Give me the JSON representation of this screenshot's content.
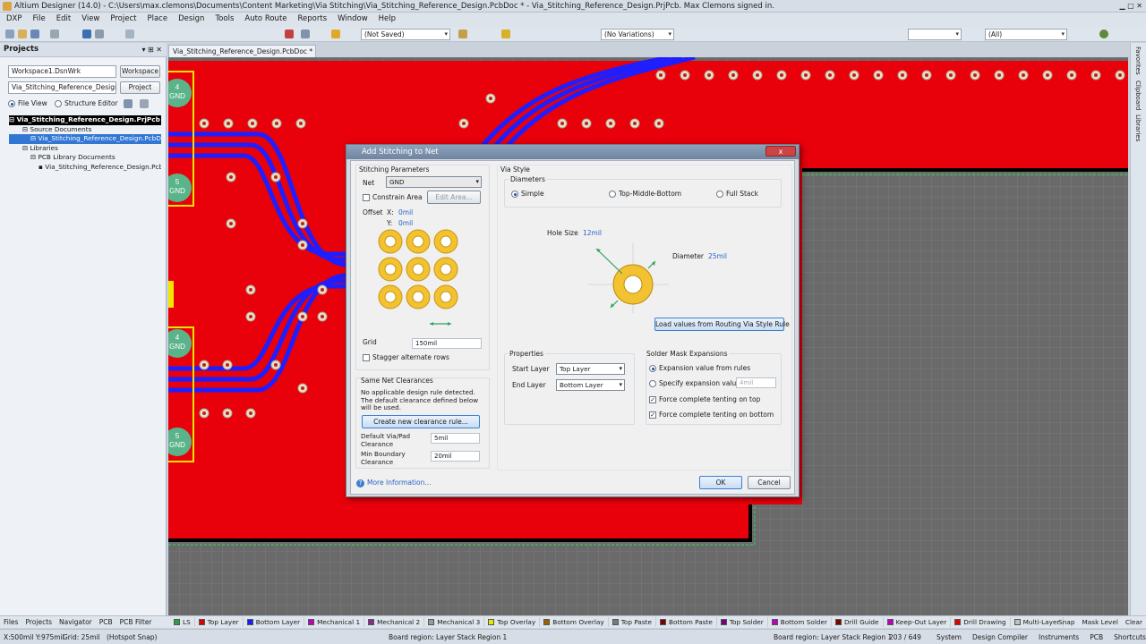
{
  "window": {
    "title": "Altium Designer (14.0) - C:\\Users\\max.clemons\\Documents\\Content Marketing\\Via Stitching\\Via_Stitching_Reference_Design.PcbDoc * - Via_Stitching_Reference_Design.PrjPcb. Max Clemons signed in."
  },
  "menu": [
    "DXP",
    "File",
    "Edit",
    "View",
    "Project",
    "Place",
    "Design",
    "Tools",
    "Auto Route",
    "Reports",
    "Window",
    "Help"
  ],
  "toolbar": {
    "saved_state": "(Not Saved)",
    "variations": "(No Variations)",
    "filter": "(All)"
  },
  "projects_panel": {
    "title": "Projects",
    "workspace_combo": "Workspace1.DsnWrk",
    "workspace_button": "Workspace",
    "project_combo": "Via_Stitching_Reference_Design.PrjPcb",
    "project_button": "Project",
    "file_view": "File View",
    "structure_editor": "Structure Editor",
    "tree": [
      {
        "label": "Via_Stitching_Reference_Design.PrjPcb",
        "level": 0,
        "style": "root"
      },
      {
        "label": "Source Documents",
        "level": 1,
        "style": ""
      },
      {
        "label": "Via_Stitching_Reference_Design.PcbDoc",
        "level": 2,
        "style": "sel"
      },
      {
        "label": "Libraries",
        "level": 1,
        "style": ""
      },
      {
        "label": "PCB Library Documents",
        "level": 2,
        "style": ""
      },
      {
        "label": "Via_Stitching_Reference_Design.PcbLib",
        "level": 3,
        "style": ""
      }
    ]
  },
  "document_tab": "Via_Stitching_Reference_Design.PcbDoc *",
  "right_strip": [
    "Favorites",
    "Clipboard",
    "Libraries"
  ],
  "pads": [
    {
      "num": "4",
      "net": "GND"
    },
    {
      "num": "5",
      "net": "GND"
    },
    {
      "num": "4",
      "net": "GND"
    },
    {
      "num": "5",
      "net": "GND"
    }
  ],
  "dialog": {
    "title": "Add Stitching to Net",
    "close": "x",
    "stitching_parameters": "Stitching Parameters",
    "net_label": "Net",
    "net_value": "GND",
    "constrain_area": "Constrain Area",
    "edit_area": "Edit Area...",
    "offset_label": "Offset",
    "offset_x_label": "X:",
    "offset_x": "0mil",
    "offset_y_label": "Y:",
    "offset_y": "0mil",
    "grid_label": "Grid",
    "grid_value": "150mil",
    "stagger": "Stagger alternate rows",
    "same_net_clearances": "Same Net Clearances",
    "clearance_note": "No applicable design rule detected. The default clearance defined below will be used.",
    "create_rule": "Create new clearance rule...",
    "default_via_label": "Default Via/Pad Clearance",
    "default_via_value": "5mil",
    "min_boundary_label": "Min Boundary Clearance",
    "min_boundary_value": "20mil",
    "more_info": "More Information...",
    "via_style": "Via Style",
    "diameters": "Diameters",
    "opt_simple": "Simple",
    "opt_tmb": "Top-Middle-Bottom",
    "opt_full": "Full Stack",
    "hole_size_label": "Hole Size",
    "hole_size": "12mil",
    "diameter_label": "Diameter",
    "diameter": "25mil",
    "load_values": "Load values from Routing Via Style Rule",
    "properties": "Properties",
    "start_layer_label": "Start Layer",
    "start_layer": "Top Layer",
    "end_layer_label": "End Layer",
    "end_layer": "Bottom Layer",
    "solder_mask": "Solder Mask Expansions",
    "mask_from_rules": "Expansion value from rules",
    "mask_specify": "Specify expansion value",
    "mask_value": "4mil",
    "tent_top": "Force complete tenting on top",
    "tent_bottom": "Force complete tenting on bottom",
    "ok": "OK",
    "cancel": "Cancel"
  },
  "panel_tabs": [
    "Files",
    "Projects",
    "Navigator",
    "PCB",
    "PCB Filter"
  ],
  "layers": [
    {
      "name": "LS",
      "color": "#2ea043"
    },
    {
      "name": "Top Layer",
      "color": "#e00000"
    },
    {
      "name": "Bottom Layer",
      "color": "#1a1aff"
    },
    {
      "name": "Mechanical 1",
      "color": "#c000c0"
    },
    {
      "name": "Mechanical 2",
      "color": "#8b2a8b"
    },
    {
      "name": "Mechanical 3",
      "color": "#9a9a9a"
    },
    {
      "name": "Top Overlay",
      "color": "#e6e600"
    },
    {
      "name": "Bottom Overlay",
      "color": "#a06000"
    },
    {
      "name": "Top Paste",
      "color": "#7a7a7a"
    },
    {
      "name": "Bottom Paste",
      "color": "#800000"
    },
    {
      "name": "Top Solder",
      "color": "#7a007a"
    },
    {
      "name": "Bottom Solder",
      "color": "#c000c0"
    },
    {
      "name": "Drill Guide",
      "color": "#800000"
    },
    {
      "name": "Keep-Out Layer",
      "color": "#c000c0"
    },
    {
      "name": "Drill Drawing",
      "color": "#e00000"
    },
    {
      "name": "Multi-Layer",
      "color": "#c0c0c0"
    }
  ],
  "layer_right": [
    "Snap",
    "Mask Level",
    "Clear"
  ],
  "status": {
    "coords": "X:500mil Y:975mil",
    "grid": "Grid: 25mil",
    "snap": "(Hotspot Snap)",
    "board_region": "Board region: Layer Stack Region 1",
    "board_region_right": "Board region: Layer Stack Region 1",
    "count": "203 / 649",
    "tabs": [
      "System",
      "Design Compiler",
      "Instruments",
      "PCB",
      "Shortcuts"
    ]
  },
  "colors": {
    "board": "#e8000b",
    "trace": "#1e1eff",
    "pad": "#f2c230",
    "grid_bg": "#6b6b6b"
  }
}
